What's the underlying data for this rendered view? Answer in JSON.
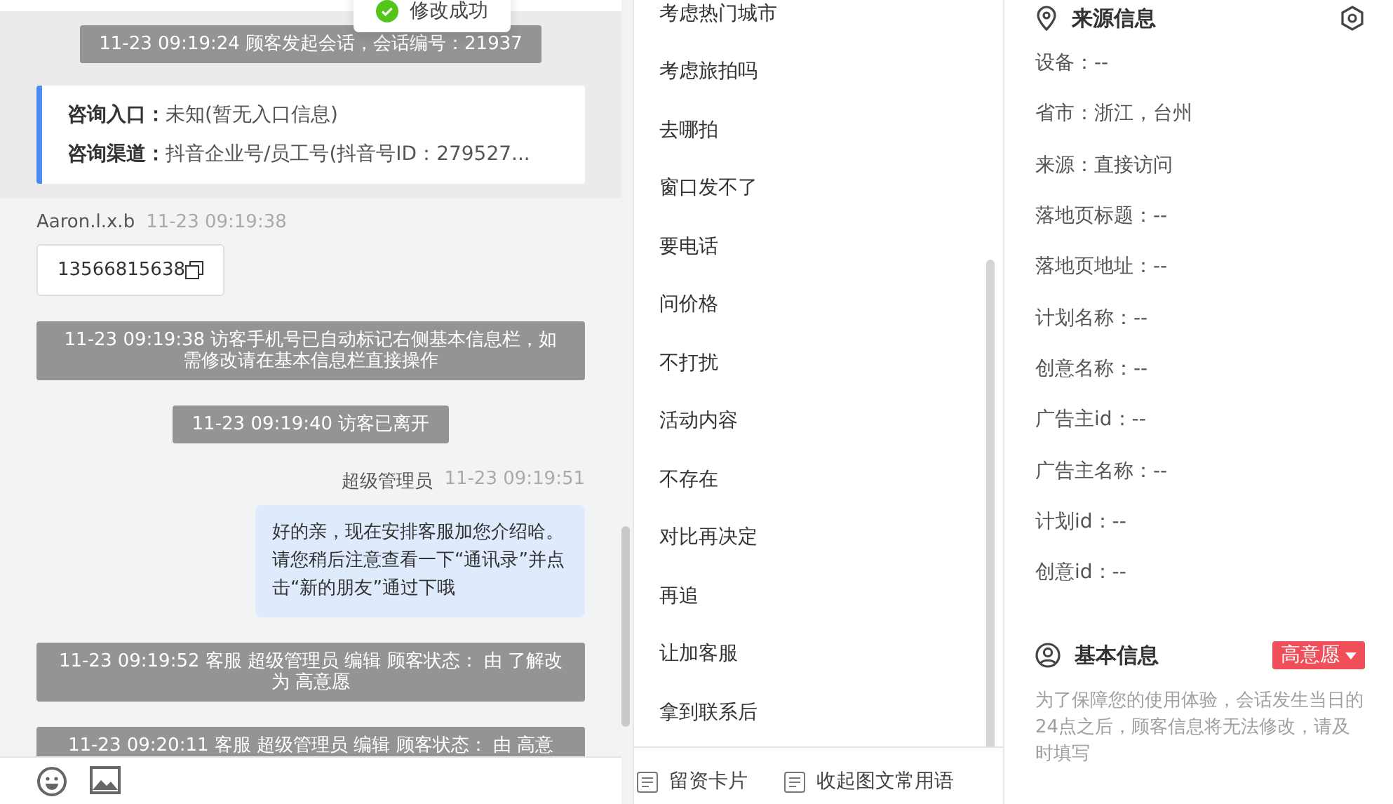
{
  "toast": {
    "text": "修改成功"
  },
  "chat": {
    "messages": [
      {
        "kind": "system",
        "text": "11-23 09:19:24 顾客发起会话，会话编号：21937"
      },
      {
        "kind": "info",
        "rows": [
          {
            "label": "咨询入口：",
            "value": "未知(暂无入口信息)"
          },
          {
            "label": "咨询渠道：",
            "value": "抖音企业号/员工号(抖音号ID：279527..."
          }
        ]
      },
      {
        "kind": "incoming",
        "sender": "Aaron.l.x.b",
        "time": "11-23 09:19:38",
        "text": "13566815638"
      },
      {
        "kind": "system",
        "text": "11-23 09:19:38 访客手机号已自动标记右侧基本信息栏，如需修改请在基本信息栏直接操作"
      },
      {
        "kind": "system",
        "text": "11-23 09:19:40 访客已离开"
      },
      {
        "kind": "outgoing",
        "sender": "超级管理员",
        "time": "11-23 09:19:51",
        "text": "好的亲，现在安排客服加您介绍哈。请您稍后注意查看一下“通讯录”并点击“新的朋友”通过下哦"
      },
      {
        "kind": "system",
        "text": "11-23 09:19:52 客服 超级管理员 编辑 顾客状态： 由 了解改为 高意愿"
      },
      {
        "kind": "system",
        "text": "11-23 09:20:11 客服 超级管理员 编辑 顾客状态： 由 高意"
      }
    ]
  },
  "quick_replies": {
    "items": [
      "考虑热门城市",
      "考虑旅拍吗",
      "去哪拍",
      "窗口发不了",
      "要电话",
      "问价格",
      "不打扰",
      "活动内容",
      "不存在",
      "对比再决定",
      "再追",
      "让加客服",
      "拿到联系后"
    ],
    "footer_buttons": [
      "留资卡片",
      "收起图文常用语"
    ]
  },
  "source_info": {
    "title": "来源信息",
    "fields": [
      "设备：--",
      "省市：浙江，台州",
      "来源：直接访问",
      "落地页标题：--",
      "落地页地址：--",
      "计划名称：--",
      "创意名称：--",
      "广告主id：--",
      "广告主名称：--",
      "计划id：--",
      "创意id：--"
    ]
  },
  "basic_info": {
    "title": "基本信息",
    "status": "高意愿",
    "note": "为了保障您的使用体验，会话发生当日的24点之后，顾客信息将无法修改，请及时填写"
  }
}
